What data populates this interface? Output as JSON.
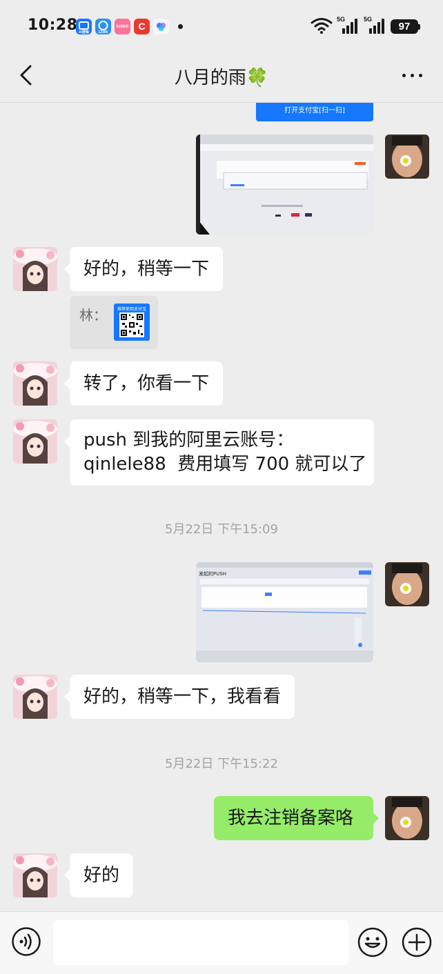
{
  "status_bar": {
    "time": "10:28",
    "network_1": "5G",
    "network_2": "5G",
    "battery": "97",
    "app_icons": [
      {
        "name": "app-icon-1",
        "color": "#1677ff",
        "text": "AI搜索"
      },
      {
        "name": "app-icon-2",
        "color": "#2b8ff5",
        "text": "12306"
      },
      {
        "name": "app-icon-3",
        "color": "#fb7299",
        "text": "bilibili"
      },
      {
        "name": "app-icon-4",
        "color": "#e83a30",
        "text": "C"
      },
      {
        "name": "app-icon-5",
        "color": "#f4f6fb",
        "text": ""
      }
    ]
  },
  "header": {
    "title": "八月的雨🍀"
  },
  "messages": [
    {
      "type": "partial-button",
      "text": "打开支付宝[扫一扫]"
    },
    {
      "type": "image",
      "sender": "me",
      "description_icon": "webpage-photo"
    },
    {
      "type": "text",
      "sender": "friend",
      "text": "好的，稍等一下"
    },
    {
      "type": "qr-quote",
      "sender": "friend",
      "label": "林：",
      "card_title": "推荐使用支付宝"
    },
    {
      "type": "text",
      "sender": "friend",
      "text": "转了，你看一下"
    },
    {
      "type": "text",
      "sender": "friend",
      "lines": [
        "push 到我的阿里云账号：",
        "qinlele88  费用填写 700 就可以了"
      ]
    },
    {
      "type": "timestamp",
      "text": "5月22日 下午15:09"
    },
    {
      "type": "image",
      "sender": "me",
      "screen_title": "发起的PUSH"
    },
    {
      "type": "text",
      "sender": "friend",
      "text": "好的，稍等一下，我看看"
    },
    {
      "type": "timestamp",
      "text": "5月22日 下午15:22"
    },
    {
      "type": "text",
      "sender": "me",
      "text": "我去注销备案咯"
    },
    {
      "type": "text",
      "sender": "friend",
      "text": "好的"
    }
  ],
  "colors": {
    "background": "#ededed",
    "my_bubble": "#95ec69",
    "friend_bubble": "#ffffff",
    "alipay_blue": "#1677ff"
  }
}
